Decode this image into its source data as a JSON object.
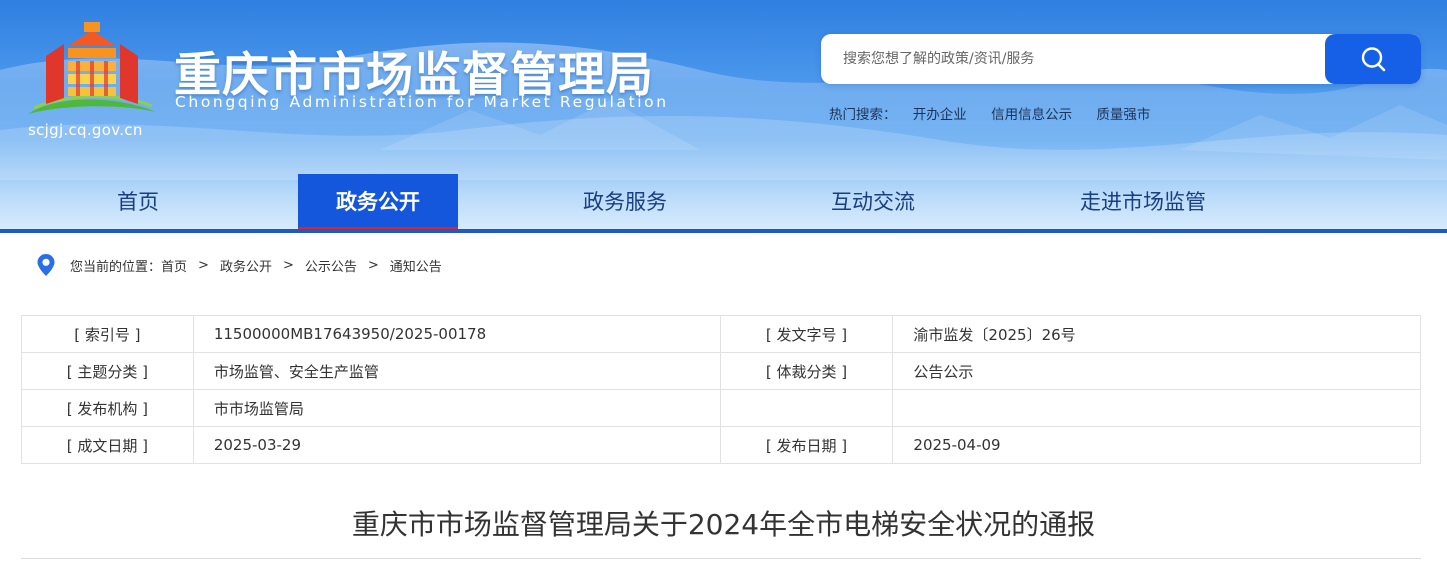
{
  "header": {
    "title": "重庆市市场监督管理局",
    "subtitle": "Chongqing  Administration for Market Regulation",
    "domain": "scjgj.cq.gov.cn",
    "logo_icon": "government-building-emblem-icon",
    "colors": {
      "sky": "#2f7fe0",
      "brand_blue": "#1456dc",
      "accent_red": "#e62121"
    }
  },
  "search": {
    "placeholder": "搜索您想了解的政策/资讯/服务",
    "button_icon": "search-icon",
    "hot_label": "热门搜索：",
    "hot_terms": [
      "开办企业",
      "信用信息公示",
      "质量强市"
    ]
  },
  "nav": {
    "items": [
      {
        "label": "首页",
        "active": false
      },
      {
        "label": "政务公开",
        "active": true
      },
      {
        "label": "政务服务",
        "active": false
      },
      {
        "label": "互动交流",
        "active": false
      },
      {
        "label": "走进市场监管",
        "active": false
      }
    ]
  },
  "breadcrumb": {
    "icon": "location-pin-icon",
    "prefix": "您当前的位置：",
    "items": [
      "首页",
      "政务公开",
      "公示公告",
      "通知公告"
    ],
    "separator": ">"
  },
  "meta": {
    "rows": [
      [
        {
          "k": "[ 索引号 ]",
          "v": "11500000MB17643950/2025-00178"
        },
        {
          "k": "[ 发文字号 ]",
          "v": "渝市监发〔2025〕26号"
        }
      ],
      [
        {
          "k": "[ 主题分类 ]",
          "v": "市场监管、安全生产监管"
        },
        {
          "k": "[ 体裁分类 ]",
          "v": "公告公示"
        }
      ],
      [
        {
          "k": "[ 发布机构 ]",
          "v": "市市场监管局"
        },
        {
          "k": "",
          "v": ""
        }
      ],
      [
        {
          "k": "[ 成文日期 ]",
          "v": "2025-03-29"
        },
        {
          "k": "[ 发布日期 ]",
          "v": "2025-04-09"
        }
      ]
    ]
  },
  "article": {
    "title": "重庆市市场监督管理局关于2024年全市电梯安全状况的通报"
  }
}
